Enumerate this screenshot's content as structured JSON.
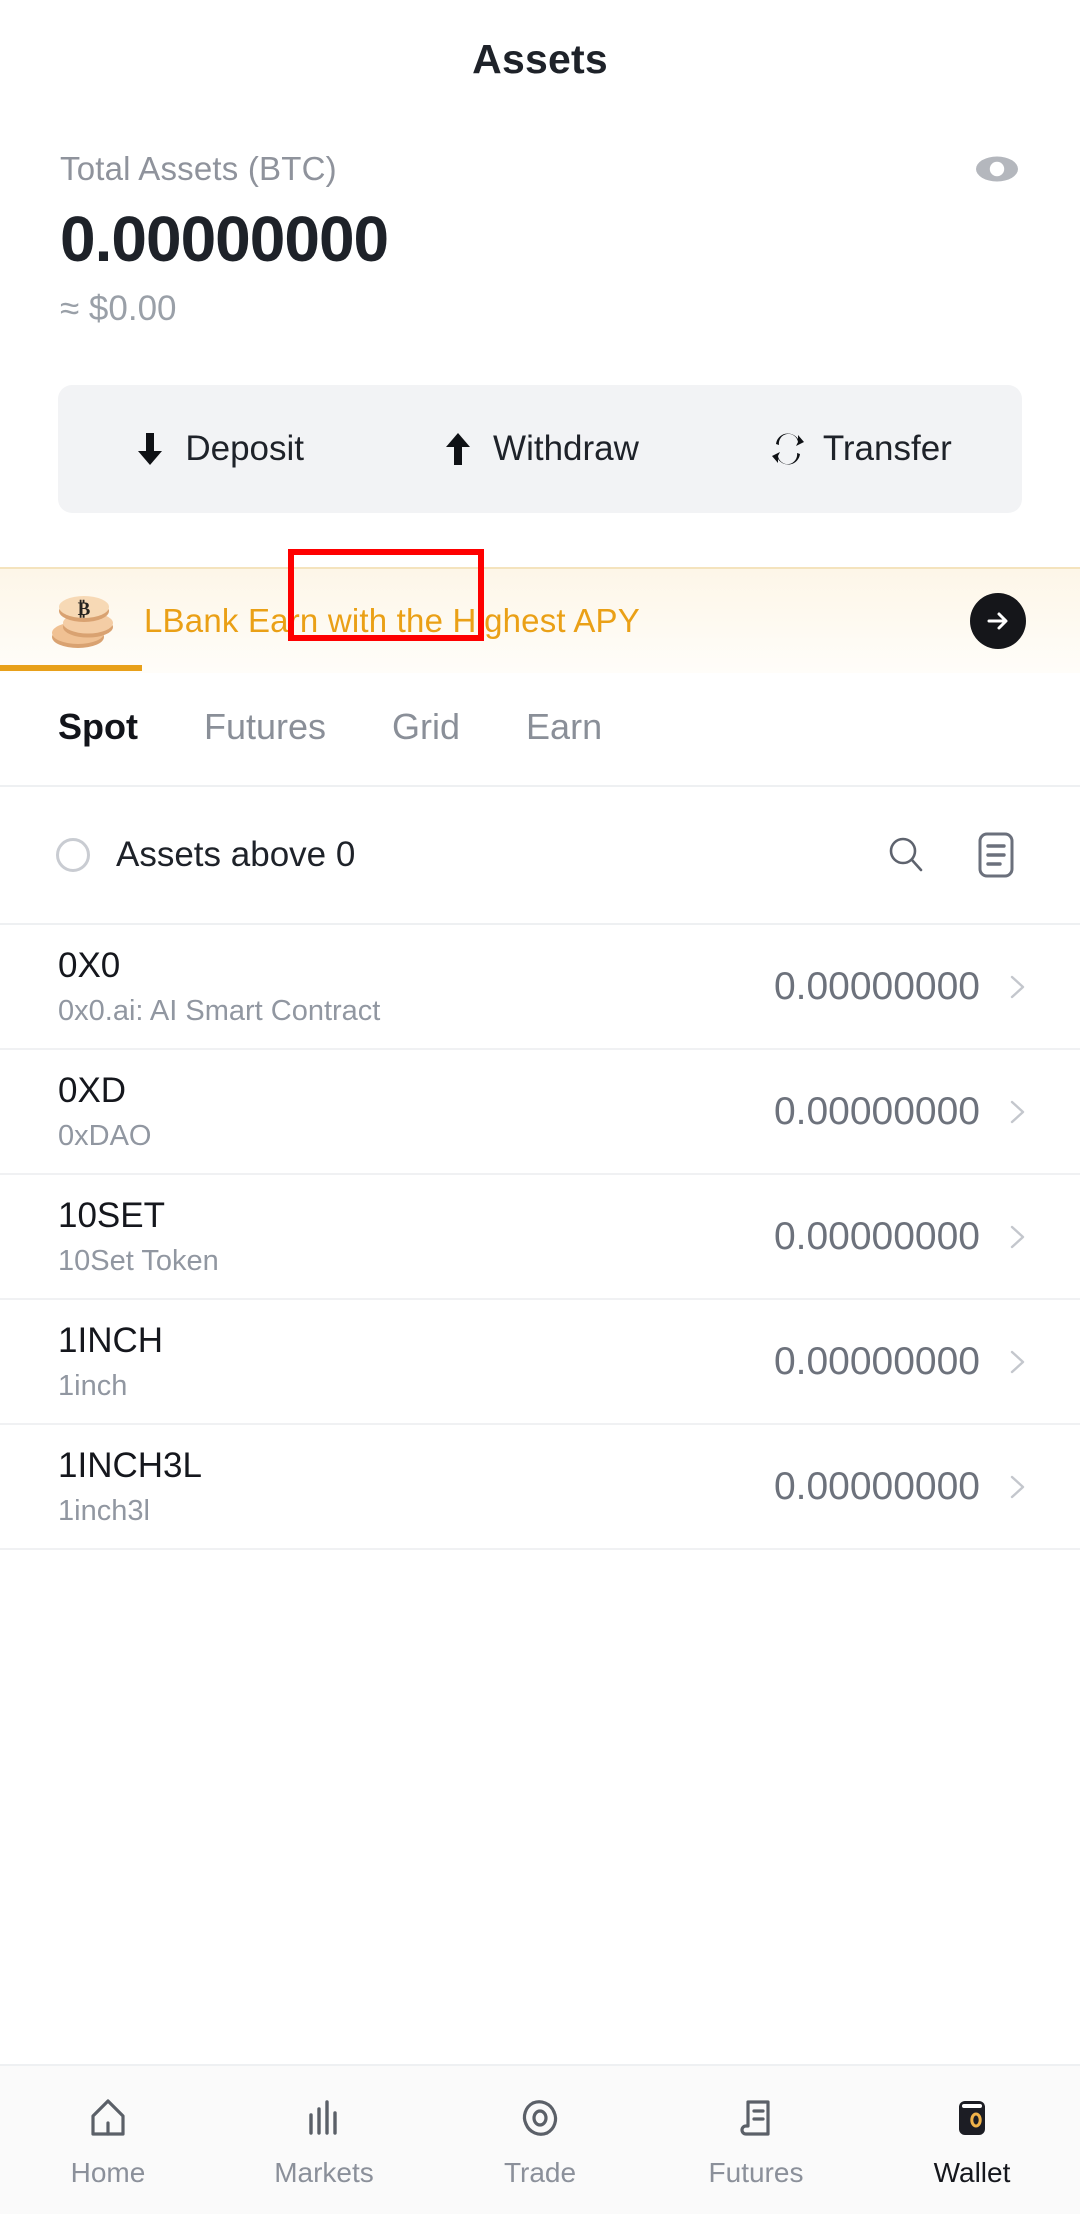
{
  "header": {
    "title": "Assets"
  },
  "totals": {
    "label": "Total Assets (BTC)",
    "value": "0.00000000",
    "approx": "≈ $0.00",
    "eye_icon": "eye-icon"
  },
  "actions": [
    {
      "label": "Deposit",
      "icon": "arrow-down-icon"
    },
    {
      "label": "Withdraw",
      "icon": "arrow-up-icon"
    },
    {
      "label": "Transfer",
      "icon": "transfer-icon"
    }
  ],
  "promo": {
    "text": "LBank Earn with the Highest APY",
    "icon": "bitcoin-coins-icon",
    "arrow_icon": "arrow-right-circle-icon",
    "text_color": "#eaa016"
  },
  "tabs": [
    {
      "label": "Spot",
      "active": true
    },
    {
      "label": "Futures",
      "active": false
    },
    {
      "label": "Grid",
      "active": false
    },
    {
      "label": "Earn",
      "active": false
    }
  ],
  "filter": {
    "label": "Assets above 0",
    "checked": false,
    "search_icon": "search-icon",
    "list_icon": "list-records-icon"
  },
  "assets": [
    {
      "symbol": "0X0",
      "name": "0x0.ai: AI Smart Contract",
      "amount": "0.00000000"
    },
    {
      "symbol": "0XD",
      "name": "0xDAO",
      "amount": "0.00000000"
    },
    {
      "symbol": "10SET",
      "name": "10Set Token",
      "amount": "0.00000000"
    },
    {
      "symbol": "1INCH",
      "name": "1inch",
      "amount": "0.00000000"
    },
    {
      "symbol": "1INCH3L",
      "name": "1inch3l",
      "amount": "0.00000000"
    }
  ],
  "bottom_nav": [
    {
      "label": "Home",
      "icon": "home-icon",
      "active": false
    },
    {
      "label": "Markets",
      "icon": "markets-icon",
      "active": false
    },
    {
      "label": "Trade",
      "icon": "trade-icon",
      "active": false
    },
    {
      "label": "Futures",
      "icon": "futures-icon",
      "active": false
    },
    {
      "label": "Wallet",
      "icon": "wallet-icon",
      "active": true
    }
  ],
  "highlight": {
    "target": "Withdraw",
    "color": "#fe0000"
  }
}
